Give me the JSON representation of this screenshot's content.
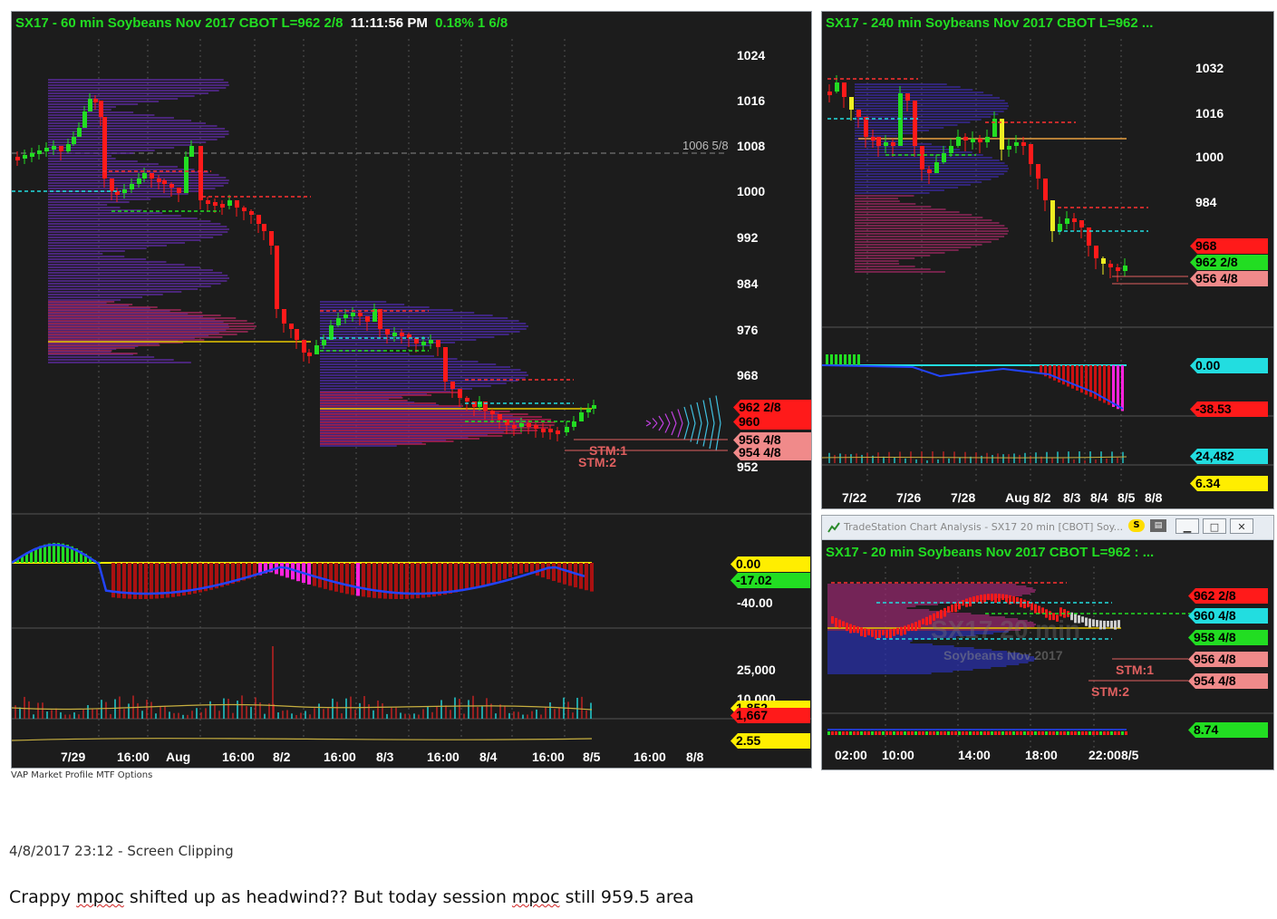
{
  "main_chart": {
    "title_prefix": "SX17 - 60 min  Soybeans Nov 2017  CBOT  L=962 2/8",
    "clock": "11:11:56 PM",
    "title_suffix": "0.18%  1 6/8",
    "price_axis": [
      "1024",
      "1016",
      "1008",
      "1000",
      "992",
      "984",
      "976",
      "968",
      "952"
    ],
    "ref_line_label": "1006 5/8",
    "price_tags": [
      {
        "text": "962 2/8",
        "bg": "#ff1a1a",
        "fg": "#000000"
      },
      {
        "text": "960",
        "bg": "#ff1a1a",
        "fg": "#000000"
      },
      {
        "text": "956 4/8",
        "bg": "#f08a8a",
        "fg": "#000000"
      },
      {
        "text": "954 4/8",
        "bg": "#f08a8a",
        "fg": "#000000"
      }
    ],
    "stm1": "STM:1",
    "stm2": "STM:2",
    "osc_tags": [
      {
        "text": "0.00",
        "bg": "#ffee00",
        "fg": "#000000"
      },
      {
        "text": "-17.02",
        "bg": "#22dd22",
        "fg": "#000000"
      }
    ],
    "osc_axis": "-40.00",
    "vol_axis": [
      "25,000",
      "10,000"
    ],
    "vol_tags": [
      {
        "text": "1,852",
        "bg": "#ffee00",
        "fg": "#000000"
      },
      {
        "text": "1,667",
        "bg": "#ff1a1a",
        "fg": "#000000"
      },
      {
        "text": "2.55",
        "bg": "#ffee00",
        "fg": "#000000"
      }
    ],
    "x_labels": [
      "7/29",
      "16:00",
      "Aug",
      "16:00",
      "8/2",
      "16:00",
      "8/3",
      "16:00",
      "8/4",
      "16:00",
      "8/5",
      "16:00",
      "8/8"
    ]
  },
  "chart_240": {
    "title": "SX17 - 240 min  Soybeans Nov 2017  CBOT  L=962 ...",
    "price_axis": [
      "1032",
      "1016",
      "1000",
      "984"
    ],
    "price_tags": [
      {
        "text": "968",
        "bg": "#ff1a1a",
        "fg": "#000000"
      },
      {
        "text": "962 2/8",
        "bg": "#22dd22",
        "fg": "#000000"
      },
      {
        "text": "956 4/8",
        "bg": "#f08a8a",
        "fg": "#000000"
      }
    ],
    "osc_tags": [
      {
        "text": "0.00",
        "bg": "#22dde0",
        "fg": "#000000"
      },
      {
        "text": "-38.53",
        "bg": "#ff1a1a",
        "fg": "#000000"
      }
    ],
    "vol_tags": [
      {
        "text": "24,482",
        "bg": "#22dde0",
        "fg": "#000000"
      },
      {
        "text": "6.34",
        "bg": "#ffee00",
        "fg": "#000000"
      }
    ],
    "x_labels": [
      "7/22",
      "7/26",
      "7/28",
      "Aug 8/2",
      "8/3",
      "8/4",
      "8/5",
      "8/8"
    ]
  },
  "ts_window": {
    "window_title": "TradeStation Chart Analysis - SX17 20 min [CBOT] Soy...",
    "title": "SX17 - 20 min  Soybeans Nov 2017  CBOT  L=962 : ...",
    "watermark_symbol": "SX17 20 min",
    "watermark_name": "Soybeans Nov 2017",
    "price_tags": [
      {
        "text": "962 2/8",
        "bg": "#ff1a1a",
        "fg": "#000000"
      },
      {
        "text": "960 4/8",
        "bg": "#22dde0",
        "fg": "#000000"
      },
      {
        "text": "958 4/8",
        "bg": "#22dd22",
        "fg": "#000000"
      },
      {
        "text": "956 4/8",
        "bg": "#f08a8a",
        "fg": "#000000"
      },
      {
        "text": "954 4/8",
        "bg": "#f08a8a",
        "fg": "#000000"
      }
    ],
    "stm1": "STM:1",
    "stm2": "STM:2",
    "vol_tags": [
      {
        "text": "8.74",
        "bg": "#22dd22",
        "fg": "#000000"
      }
    ],
    "x_labels": [
      "02:00",
      "10:00",
      "14:00",
      "18:00",
      "22:00",
      "8/5"
    ]
  },
  "clipping": {
    "timestamp": "4/8/2017 23:12 - Screen Clipping",
    "note_part1": "Crappy ",
    "note_word1": "mpoc",
    "note_part2": " shifted up as headwind?? But today session ",
    "note_word2": "mpoc",
    "note_part3": " still 959.5 area"
  },
  "workspace_tabs": "VAP  Market Profile  MTF  Options"
}
